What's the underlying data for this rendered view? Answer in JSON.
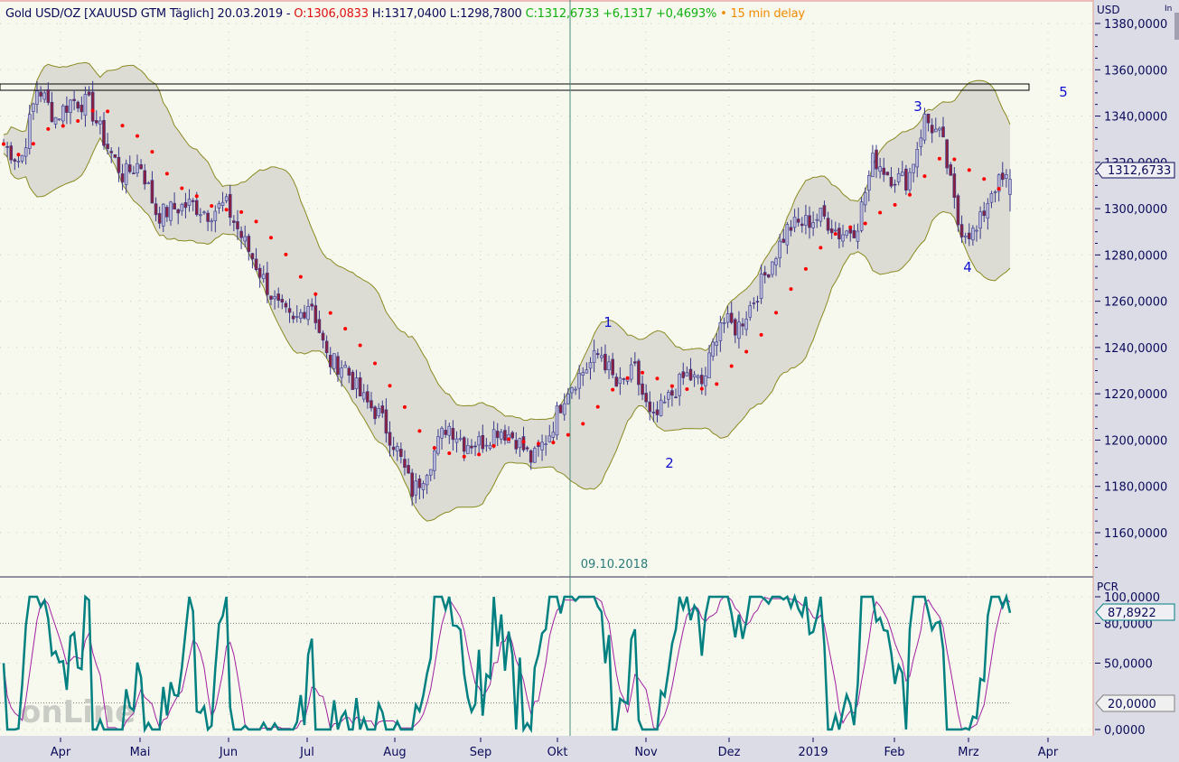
{
  "header": {
    "instrument": "Gold USD/OZ [XAUUSD GTM Täglich] 20.03.2019 -",
    "open": "O:1306,0833",
    "hl": "H:1317,0400 L:1298,7800",
    "close": "C:1312,6733 +6,1317 +0,4693%",
    "delay": "• 15 min delay"
  },
  "price_axis": {
    "unit": "USD",
    "corner": "In",
    "current": "1312,6733",
    "ticks": [
      "1380,0000",
      "1360,0000",
      "1340,0000",
      "1320,0000",
      "1300,0000",
      "1280,0000",
      "1260,0000",
      "1240,0000",
      "1220,0000",
      "1200,0000",
      "1180,0000",
      "1160,0000"
    ]
  },
  "osc_axis": {
    "unit": "PCR",
    "current": "87,8922",
    "level_label": "20,0000",
    "ticks": [
      "100,0000",
      "80,0000",
      "50,0000",
      "0,0000"
    ]
  },
  "months": [
    "Apr",
    "Mai",
    "Jun",
    "Jul",
    "Aug",
    "Sep",
    "Okt",
    "Nov",
    "Dez",
    "2019",
    "Feb",
    "Mrz",
    "Apr"
  ],
  "crosshair_date": "09.10.2018",
  "annotations": [
    "1",
    "2",
    "3",
    "4",
    "5"
  ],
  "watermark": "onLine",
  "colors": {
    "bg": "#f7f9ef",
    "candle": "#3a3a8c",
    "band": "#8a8a20",
    "sma": "#ff0000",
    "osc": "#008080",
    "signal": "#a020a0"
  },
  "chart_data": {
    "type": "candlestick",
    "title": "Gold USD/OZ [XAUUSD GTM Täglich]",
    "ylim": [
      1150,
      1385
    ],
    "approx_weekly_closes": [
      1328,
      1320,
      1353,
      1339,
      1347,
      1345,
      1328,
      1314,
      1320,
      1297,
      1300,
      1302,
      1298,
      1302,
      1287,
      1273,
      1258,
      1250,
      1261,
      1234,
      1232,
      1218,
      1211,
      1197,
      1177,
      1191,
      1207,
      1199,
      1199,
      1205,
      1201,
      1191,
      1203,
      1222,
      1230,
      1238,
      1222,
      1230,
      1207,
      1218,
      1228,
      1224,
      1252,
      1248,
      1261,
      1277,
      1292,
      1294,
      1297,
      1289,
      1292,
      1322,
      1314,
      1312,
      1339,
      1330,
      1292,
      1289,
      1310,
      1312.67
    ],
    "indicators": [
      "Bollinger Bands (20,2)",
      "SMA 20",
      "PCR oscillator with signal"
    ],
    "osc_ylim": [
      0,
      100
    ],
    "osc_levels": [
      20,
      80
    ],
    "last": {
      "open": 1306.0833,
      "high": 1317.04,
      "low": 1298.78,
      "close": 1312.6733,
      "pcr": 87.8922
    }
  }
}
